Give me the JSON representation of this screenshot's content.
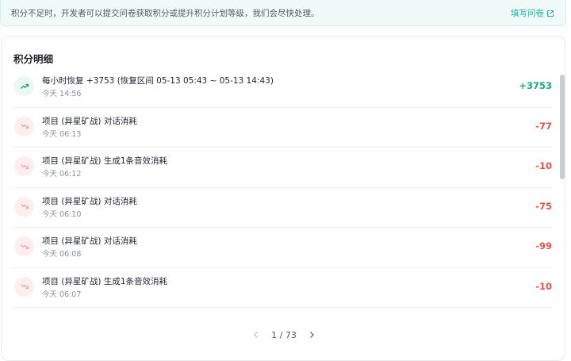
{
  "banner": {
    "text": "积分不足时，开发者可以提交问卷获取积分或提升积分计划等级，我们会尽快处理。",
    "link_label": "填写问卷",
    "link_icon": "external-link-icon"
  },
  "points": {
    "title": "积分明细",
    "records": [
      {
        "type": "up",
        "icon": "trending-up-icon",
        "title": "每小时恢复 +3753 (恢复区间 05-13 05:43 ~ 05-13 14:43)",
        "time": "今天 14:56",
        "amount": "+3753"
      },
      {
        "type": "down",
        "icon": "trending-down-icon",
        "title": "项目 (异星矿战) 对话消耗",
        "time": "今天 06:13",
        "amount": "-77"
      },
      {
        "type": "down",
        "icon": "trending-down-icon",
        "title": "项目 (异星矿战) 生成1条音效消耗",
        "time": "今天 06:12",
        "amount": "-10"
      },
      {
        "type": "down",
        "icon": "trending-down-icon",
        "title": "项目 (异星矿战) 对话消耗",
        "time": "今天 06:10",
        "amount": "-75"
      },
      {
        "type": "down",
        "icon": "trending-down-icon",
        "title": "项目 (异星矿战) 对话消耗",
        "time": "今天 06:08",
        "amount": "-99"
      },
      {
        "type": "down",
        "icon": "trending-down-icon",
        "title": "项目 (异星矿战) 生成1条音效消耗",
        "time": "今天 06:07",
        "amount": "-10"
      }
    ],
    "colors": {
      "up": "#18a978",
      "down": "#e8524a",
      "accent": "#21b39a"
    }
  },
  "pagination": {
    "current": 1,
    "total": 73,
    "label": "1 / 73",
    "prev_icon": "chevron-left-icon",
    "next_icon": "chevron-right-icon"
  }
}
